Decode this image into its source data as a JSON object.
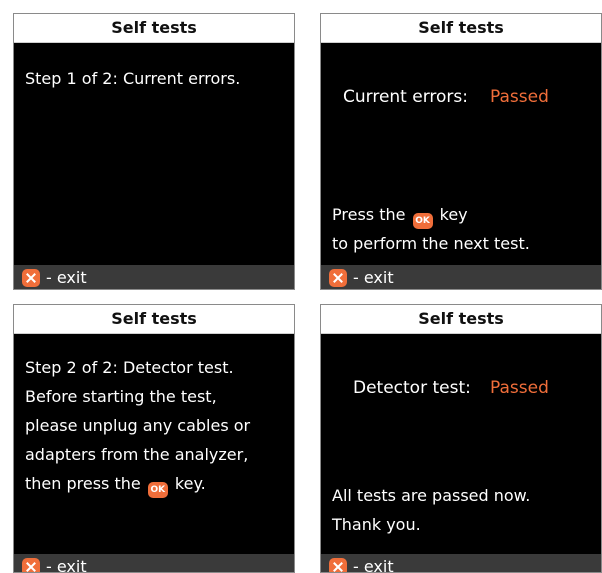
{
  "colors": {
    "accent": "#f06e3a",
    "screen_bg": "#000000",
    "footer_bg": "#3a3a3a"
  },
  "screens": [
    {
      "title": "Self tests",
      "step_text": "Step 1 of 2: Current errors.",
      "footer": {
        "icon": "x-key-icon",
        "label": "- exit"
      }
    },
    {
      "title": "Self tests",
      "status": {
        "label": "Current errors:",
        "value": "Passed"
      },
      "instruction": {
        "before": "Press the",
        "icon_text": "OK",
        "after": "key",
        "line2": "to perform the next test."
      },
      "footer": {
        "icon": "x-key-icon",
        "label": "- exit"
      }
    },
    {
      "title": "Self tests",
      "lines": [
        "Step 2 of 2: Detector test.",
        "Before starting the test,",
        "please unplug any cables or",
        "adapters from the analyzer,"
      ],
      "last_line": {
        "before": "then press the",
        "icon_text": "OK",
        "after": "key."
      },
      "footer": {
        "icon": "x-key-icon",
        "label": "- exit"
      }
    },
    {
      "title": "Self tests",
      "status": {
        "label": "Detector test:",
        "value": "Passed"
      },
      "lines": [
        "All tests are passed now.",
        "Thank you."
      ],
      "footer": {
        "icon": "x-key-icon",
        "label": "- exit"
      }
    }
  ]
}
